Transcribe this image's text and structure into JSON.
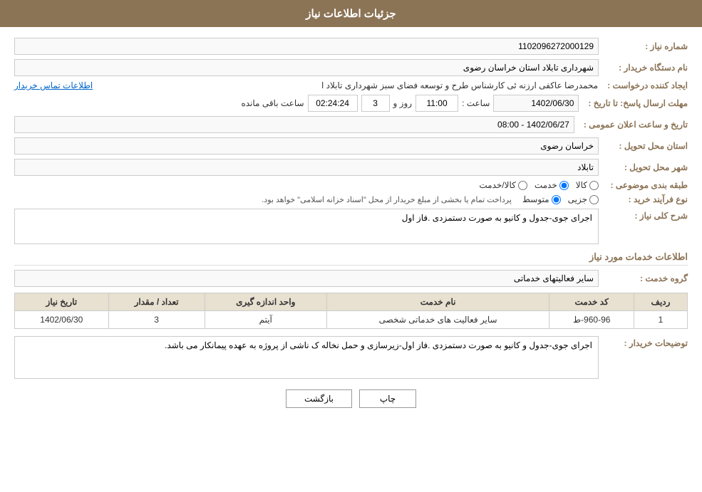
{
  "header": {
    "title": "جزئیات اطلاعات نیاز"
  },
  "fields": {
    "shomara_niaz_label": "شماره نیاز :",
    "shomara_niaz_value": "1102096272000129",
    "nam_dastgah_label": "نام دستگاه خریدار :",
    "nam_dastgah_value": "شهرداری تابلاد استان خراسان رضوی",
    "ij_konande_label": "ایجاد کننده درخواست :",
    "ij_konande_value": "محمدرضا عاکفی ارزنه ئی کارشناس طرح و توسعه فضای سبز شهرداری تابلاد ا",
    "ij_konande_link": "اطلاعات تماس خریدار",
    "mohlat_label": "مهلت ارسال پاسخ: تا تاریخ :",
    "mohlat_date": "1402/06/30",
    "mohlat_time_label": "ساعت :",
    "mohlat_time": "11:00",
    "mohlat_roz_label": "روز و",
    "mohlat_roz": "3",
    "mohlat_remaining_label": "ساعت باقی مانده",
    "mohlat_remaining": "02:24:24",
    "ostan_label": "استان محل تحویل :",
    "ostan_value": "خراسان رضوی",
    "shahr_label": "شهر محل تحویل :",
    "shahr_value": "تابلاد",
    "tabaqe_label": "طبقه بندی موضوعی :",
    "tabaqe_kala": "کالا",
    "tabaqe_khadamat": "خدمت",
    "tabaqe_kala_khadamat": "کالا/خدمت",
    "tabaqe_selected": "khadamat",
    "nooe_farayand_label": "نوع فرآیند خرید :",
    "nooe_jozii": "جزیی",
    "nooe_motavaset": "متوسط",
    "nooe_selected": "motavaset",
    "nooe_description": "پرداخت تمام یا بخشی از مبلغ خریدار از محل \"اسناد خزانه اسلامی\" خواهد بود.",
    "sharh_label": "شرح کلی نیاز :",
    "sharh_value": "اجرای جوی-جدول و کانیو به صورت دستمزدی .فاز اول",
    "services_section_title": "اطلاعات خدمات مورد نیاز",
    "group_label": "گروه خدمت :",
    "group_value": "سایر فعالیتهای خدماتی"
  },
  "table": {
    "headers": [
      "ردیف",
      "کد خدمت",
      "نام خدمت",
      "واحد اندازه گیری",
      "تعداد / مقدار",
      "تاریخ نیاز"
    ],
    "rows": [
      {
        "radif": "1",
        "kod": "960-96-ط",
        "name": "سایر فعالیت های خدماتی شخصی",
        "vahed": "آیتم",
        "tedad": "3",
        "tarikh": "1402/06/30"
      }
    ]
  },
  "tosifat_label": "توضیحات خریدار :",
  "tosifat_value": "اجرای جوی-جدول و کانیو به صورت دستمزدی .فاز اول-زیرسازی و حمل نخاله ک ناشی از پروژه به عهده پیمانکار می باشد.",
  "buttons": {
    "print": "چاپ",
    "back": "بازگشت"
  }
}
